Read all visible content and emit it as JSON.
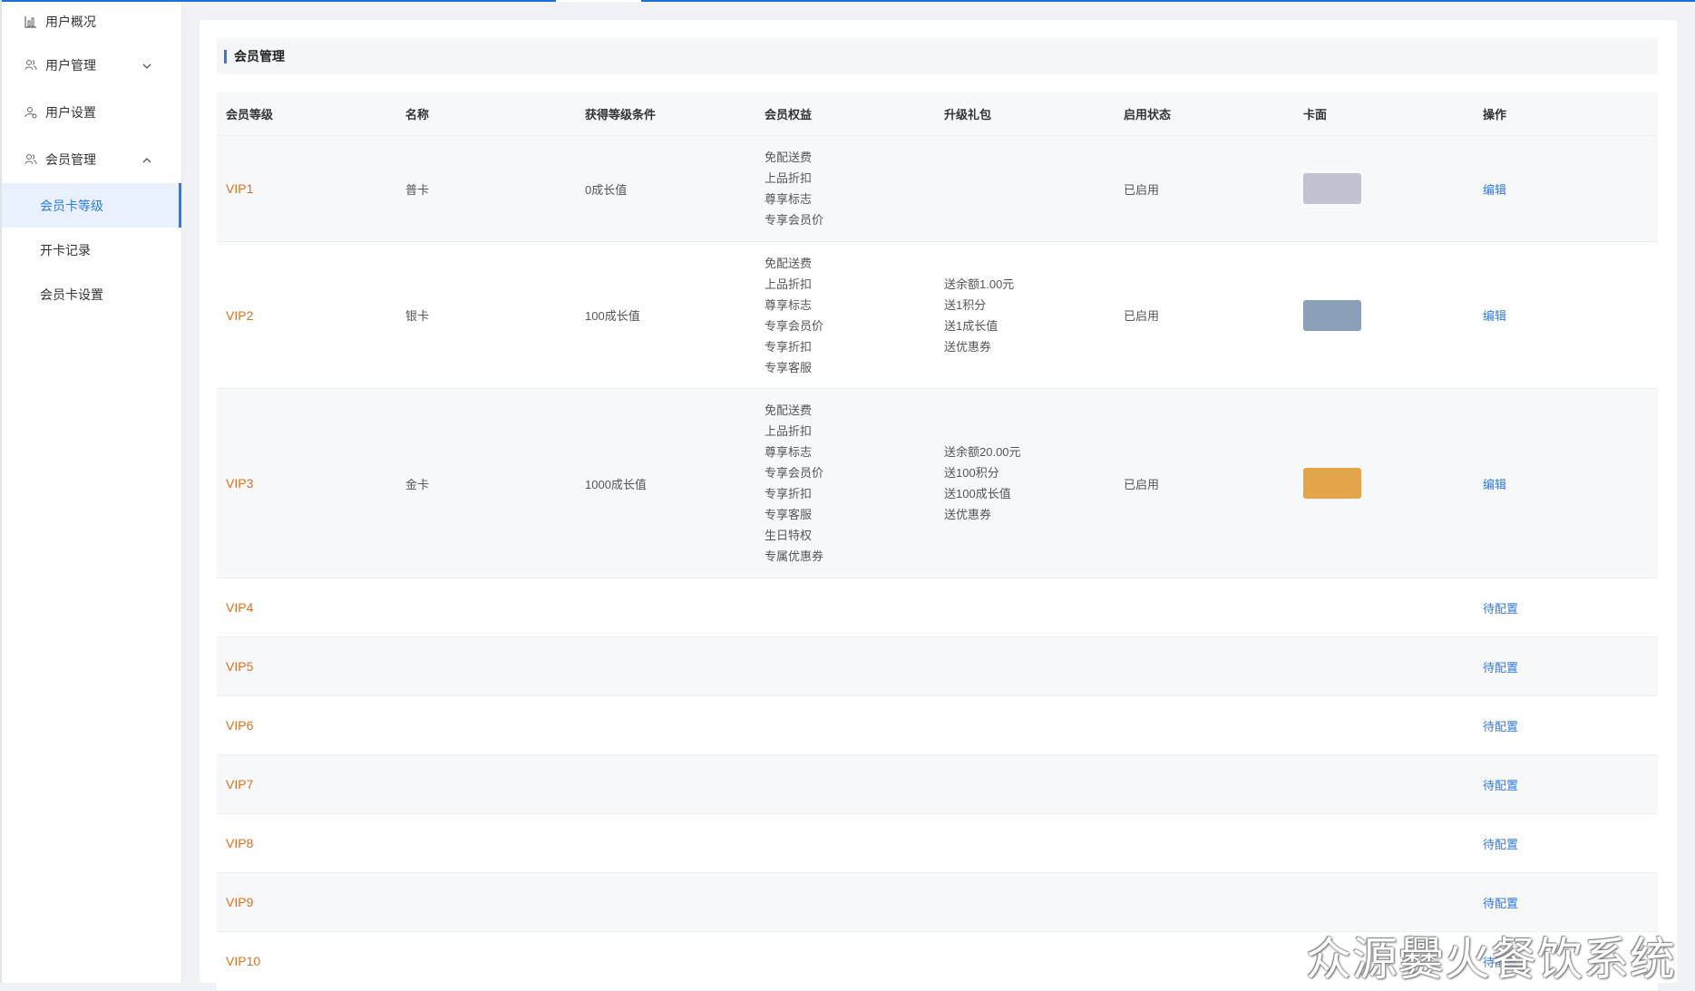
{
  "sidebar": {
    "items": [
      {
        "label": "用户概况",
        "icon": "bar-chart-icon",
        "expanded": null
      },
      {
        "label": "用户管理",
        "icon": "users-icon",
        "expanded": false
      },
      {
        "label": "用户设置",
        "icon": "user-settings-icon",
        "expanded": null
      },
      {
        "label": "会员管理",
        "icon": "members-icon",
        "expanded": true
      }
    ],
    "subitems": [
      {
        "label": "会员卡等级",
        "active": true
      },
      {
        "label": "开卡记录",
        "active": false
      },
      {
        "label": "会员卡设置",
        "active": false
      }
    ]
  },
  "section": {
    "title": "会员管理"
  },
  "table": {
    "headers": [
      "会员等级",
      "名称",
      "获得等级条件",
      "会员权益",
      "升级礼包",
      "启用状态",
      "卡面",
      "操作"
    ],
    "rows": [
      {
        "level": "VIP1",
        "name": "普卡",
        "condition": "0成长值",
        "benefits": [
          "免配送费",
          "上品折扣",
          "尊享标志",
          "专享会员价"
        ],
        "gifts": [],
        "status": "已启用",
        "card_color": "#c0c3d0",
        "action": "编辑"
      },
      {
        "level": "VIP2",
        "name": "银卡",
        "condition": "100成长值",
        "benefits": [
          "免配送费",
          "上品折扣",
          "尊享标志",
          "专享会员价",
          "专享折扣",
          "专享客服"
        ],
        "gifts": [
          "送余额1.00元",
          "送1积分",
          "送1成长值",
          "送优惠券"
        ],
        "status": "已启用",
        "card_color": "#8aa0b8",
        "action": "编辑"
      },
      {
        "level": "VIP3",
        "name": "金卡",
        "condition": "1000成长值",
        "benefits": [
          "免配送费",
          "上品折扣",
          "尊享标志",
          "专享会员价",
          "专享折扣",
          "专享客服",
          "生日特权",
          "专属优惠券"
        ],
        "gifts": [
          "送余额20.00元",
          "送100积分",
          "送100成长值",
          "送优惠券"
        ],
        "status": "已启用",
        "card_color": "#e3a54a",
        "action": "编辑"
      },
      {
        "level": "VIP4",
        "action": "待配置"
      },
      {
        "level": "VIP5",
        "action": "待配置"
      },
      {
        "level": "VIP6",
        "action": "待配置"
      },
      {
        "level": "VIP7",
        "action": "待配置"
      },
      {
        "level": "VIP8",
        "action": "待配置"
      },
      {
        "level": "VIP9",
        "action": "待配置"
      },
      {
        "level": "VIP10",
        "action": "待配置"
      }
    ]
  },
  "watermark": "众源爨火餐饮系统",
  "colors": {
    "accent": "#2f7ae5",
    "vip_text": "#e0701e",
    "active_bg": "#e8f1fd"
  }
}
